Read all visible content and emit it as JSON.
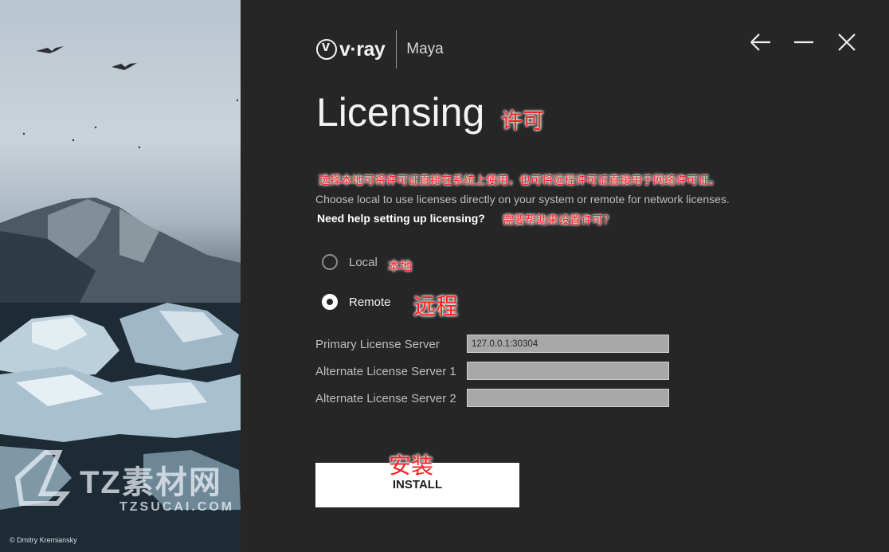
{
  "app": {
    "brand": "v·ray",
    "product": "Maya"
  },
  "window_controls": {
    "back_icon": "arrow-left-icon",
    "minimize_icon": "minimize-icon",
    "close_icon": "close-icon"
  },
  "page": {
    "title": "Licensing",
    "title_annotation": "许可",
    "description_annotation": "选择本地可将许可证直接在系统上使用，也可将远程许可证直接用于网络许可证。",
    "description": "Choose local to use licenses directly on your system or remote for network licenses.",
    "help_link": "Need help setting up licensing?",
    "help_annotation": "需要帮助来设置许可？"
  },
  "license_mode": {
    "options": [
      {
        "label": "Local",
        "annotation": "本地",
        "selected": false
      },
      {
        "label": "Remote",
        "annotation": "远程",
        "selected": true
      }
    ]
  },
  "servers": {
    "primary": {
      "label": "Primary License Server",
      "value": "127.0.0.1:30304"
    },
    "alternate1": {
      "label": "Alternate License Server 1",
      "value": ""
    },
    "alternate2": {
      "label": "Alternate License Server 2",
      "value": ""
    }
  },
  "install": {
    "label": "INSTALL",
    "annotation": "安装"
  },
  "photo": {
    "credit": "© Dmitry Kremiansky"
  },
  "watermark": {
    "main": "TZ素材网",
    "sub": "TZSUCAI.COM"
  },
  "colors": {
    "background": "#262626",
    "annotation": "#ff1f1f",
    "field_bg": "#a8a8a8",
    "button_bg": "#ffffff"
  }
}
